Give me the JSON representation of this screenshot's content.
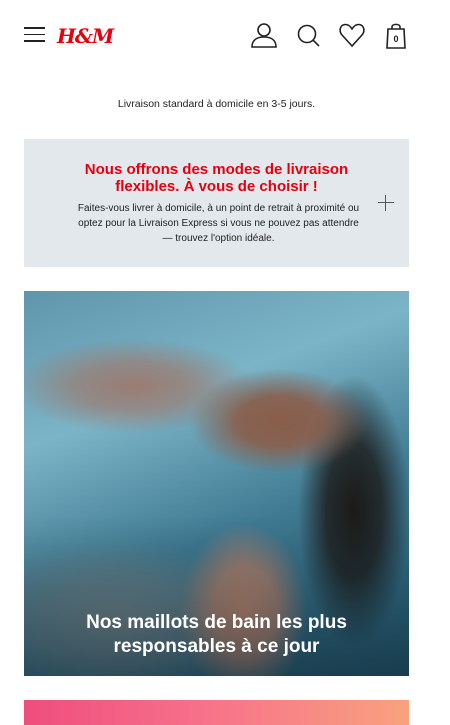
{
  "header": {
    "logo": "H&M",
    "bag_count": "0",
    "icons": [
      "menu-icon",
      "account-icon",
      "search-icon",
      "heart-icon",
      "shopping-bag-icon"
    ]
  },
  "delivery": {
    "text": "Livraison standard à domicile en 3-5 jours."
  },
  "info_panel": {
    "title": "Nous offrons des modes de livraison flexibles. À vous de choisir !",
    "text": "Faites-vous livrer à domicile, à un point de retrait à proximité ou optez pour la Livraison Express si vous ne pouvez pas attendre — trouvez l'option idéale.",
    "expand_icon": "plus-icon"
  },
  "hero": {
    "title": "Nos maillots de bain les plus responsables à ce jour"
  },
  "colors": {
    "brand_red": "#e50010",
    "panel_bg": "#e3e8ec"
  }
}
